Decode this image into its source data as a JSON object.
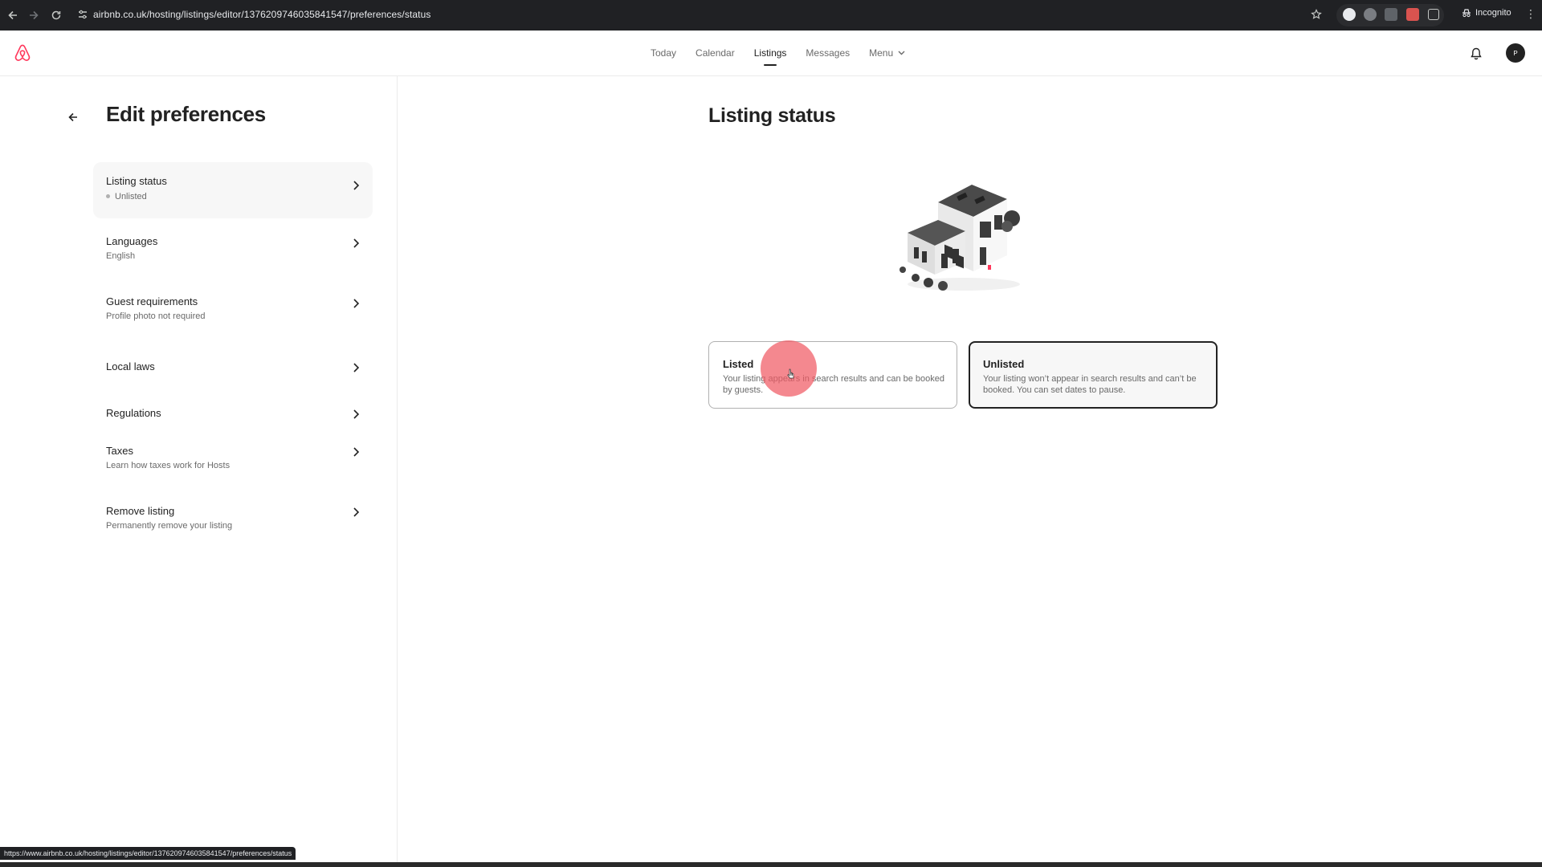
{
  "browser": {
    "url": "airbnb.co.uk/hosting/listings/editor/1376209746035841547/preferences/status",
    "incognito_label": "Incognito",
    "status_url": "https://www.airbnb.co.uk/hosting/listings/editor/1376209746035841547/preferences/status"
  },
  "topnav": {
    "links": [
      {
        "label": "Today"
      },
      {
        "label": "Calendar"
      },
      {
        "label": "Listings",
        "active": true
      },
      {
        "label": "Messages"
      },
      {
        "label": "Menu"
      }
    ],
    "avatar_initial": "P"
  },
  "sidebar": {
    "title": "Edit preferences",
    "items": [
      {
        "label": "Listing status",
        "sub": "Unlisted"
      },
      {
        "label": "Languages",
        "sub": "English"
      },
      {
        "label": "Guest requirements",
        "sub": "Profile photo not required"
      },
      {
        "label": "Local laws"
      },
      {
        "label": "Regulations"
      },
      {
        "label": "Taxes",
        "sub": "Learn how taxes work for Hosts"
      },
      {
        "label": "Remove listing",
        "sub": "Permanently remove your listing"
      }
    ]
  },
  "main": {
    "title": "Listing status",
    "options": [
      {
        "title": "Listed",
        "desc": "Your listing appears in search results and can be booked by guests."
      },
      {
        "title": "Unlisted",
        "desc": "Your listing won’t appear in search results and can’t be booked. You can set dates to pause."
      }
    ]
  },
  "colors": {
    "brand": "#FF385C",
    "text_primary": "#222222",
    "text_secondary": "#6A6A6A",
    "chrome_bg": "#202124"
  },
  "icons": [
    "back-arrow-icon",
    "forward-arrow-icon",
    "reload-icon",
    "site-info-icon",
    "star-icon",
    "incognito-icon",
    "kebab-menu-icon",
    "airbnb-logo",
    "bell-icon",
    "chevron-right-icon",
    "chevron-down-icon",
    "back-arrow-icon"
  ]
}
